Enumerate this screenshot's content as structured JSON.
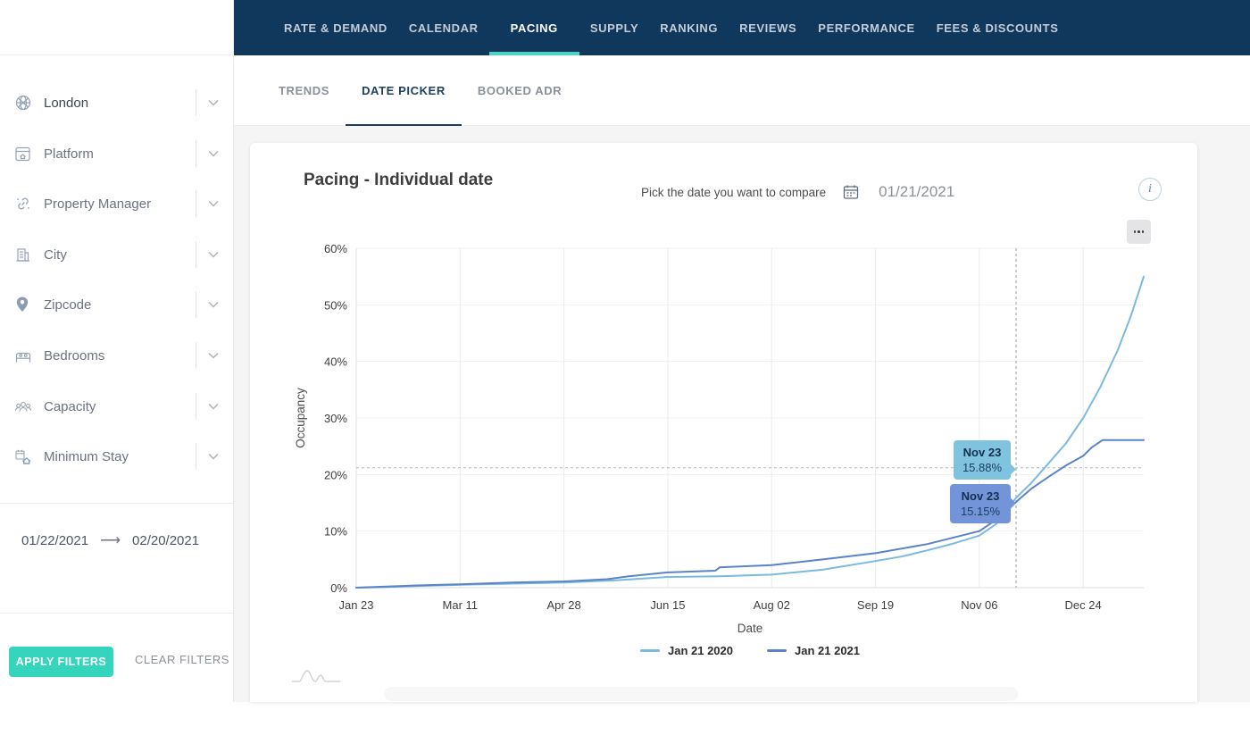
{
  "nav": {
    "items": [
      "RATE & DEMAND",
      "CALENDAR",
      "PACING",
      "SUPPLY",
      "RANKING",
      "REVIEWS",
      "PERFORMANCE",
      "FEES & DISCOUNTS"
    ],
    "active": "PACING",
    "colors": {
      "background": "#10375c",
      "active_underline": "#4ed3c4"
    }
  },
  "sidebar": {
    "filters": [
      {
        "label": "London",
        "icon": "market-icon",
        "selected": true
      },
      {
        "label": "Platform",
        "icon": "platform-icon",
        "selected": false
      },
      {
        "label": "Property Manager",
        "icon": "link-icon",
        "selected": false
      },
      {
        "label": "City",
        "icon": "building-icon",
        "selected": false
      },
      {
        "label": "Zipcode",
        "icon": "map-pin-icon",
        "selected": false
      },
      {
        "label": "Bedrooms",
        "icon": "bed-icon",
        "selected": false
      },
      {
        "label": "Capacity",
        "icon": "people-icon",
        "selected": false
      },
      {
        "label": "Minimum Stay",
        "icon": "calendar-house-icon",
        "selected": false
      }
    ],
    "date_range": {
      "start": "01/22/2021",
      "end": "02/20/2021"
    },
    "apply_label": "APPLY FILTERS",
    "clear_label": "CLEAR FILTERS",
    "apply_color": "#35d4bc"
  },
  "tabs": {
    "items": [
      "TRENDS",
      "DATE PICKER",
      "BOOKED ADR"
    ],
    "active": "DATE PICKER"
  },
  "panel": {
    "title": "Pacing - Individual date",
    "compare_label": "Pick the date you want to compare",
    "compare_date": "01/21/2021"
  },
  "chart_data": {
    "type": "line",
    "title": "Pacing - Individual date",
    "xlabel": "Date",
    "ylabel": "Occupancy",
    "x_ticks": [
      "Jan 23",
      "Mar 11",
      "Apr 28",
      "Jun 15",
      "Aug 02",
      "Sep 19",
      "Nov 06",
      "Dec 24"
    ],
    "x_tick_days": [
      0,
      48,
      96,
      144,
      192,
      240,
      288,
      336
    ],
    "x_domain_days": [
      0,
      364
    ],
    "y_ticks": [
      "0%",
      "10%",
      "20%",
      "30%",
      "40%",
      "50%",
      "60%"
    ],
    "ylim": [
      0,
      60
    ],
    "grid": true,
    "legend_position": "bottom",
    "series": [
      {
        "name": "Jan 21 2020",
        "color": "#7bbade",
        "points": [
          [
            0,
            0
          ],
          [
            14,
            0.1
          ],
          [
            28,
            0.3
          ],
          [
            48,
            0.5
          ],
          [
            70,
            0.7
          ],
          [
            96,
            0.9
          ],
          [
            120,
            1.3
          ],
          [
            144,
            1.9
          ],
          [
            168,
            2.0
          ],
          [
            192,
            2.3
          ],
          [
            216,
            3.2
          ],
          [
            240,
            4.7
          ],
          [
            252,
            5.5
          ],
          [
            264,
            6.6
          ],
          [
            276,
            7.8
          ],
          [
            288,
            9.2
          ],
          [
            296,
            11.3
          ],
          [
            305,
            15.88
          ],
          [
            312,
            18.5
          ],
          [
            320,
            22
          ],
          [
            328,
            25.5
          ],
          [
            336,
            30
          ],
          [
            344,
            35.5
          ],
          [
            352,
            42
          ],
          [
            358,
            48
          ],
          [
            364,
            55
          ]
        ]
      },
      {
        "name": "Jan 21 2021",
        "color": "#5c83c9",
        "points": [
          [
            0,
            0
          ],
          [
            14,
            0.2
          ],
          [
            28,
            0.4
          ],
          [
            48,
            0.6
          ],
          [
            72,
            0.9
          ],
          [
            96,
            1.1
          ],
          [
            116,
            1.5
          ],
          [
            126,
            2.0
          ],
          [
            144,
            2.7
          ],
          [
            166,
            3.0
          ],
          [
            168,
            3.6
          ],
          [
            192,
            4.0
          ],
          [
            216,
            5.0
          ],
          [
            240,
            6.1
          ],
          [
            264,
            7.7
          ],
          [
            288,
            10.0
          ],
          [
            297,
            12.3
          ],
          [
            305,
            15.15
          ],
          [
            312,
            17.5
          ],
          [
            320,
            19.6
          ],
          [
            328,
            21.6
          ],
          [
            336,
            23.3
          ],
          [
            340,
            24.8
          ],
          [
            345,
            26.1
          ],
          [
            364,
            26.1
          ]
        ]
      }
    ],
    "crosshair": {
      "day": 305,
      "value": 21.2
    },
    "tooltips": [
      {
        "date": "Nov 23",
        "value": "15.88%",
        "color": "#7fc3e0",
        "series": "Jan 21 2020"
      },
      {
        "date": "Nov 23",
        "value": "15.15%",
        "color": "#7394d9",
        "series": "Jan 21 2021"
      }
    ]
  }
}
